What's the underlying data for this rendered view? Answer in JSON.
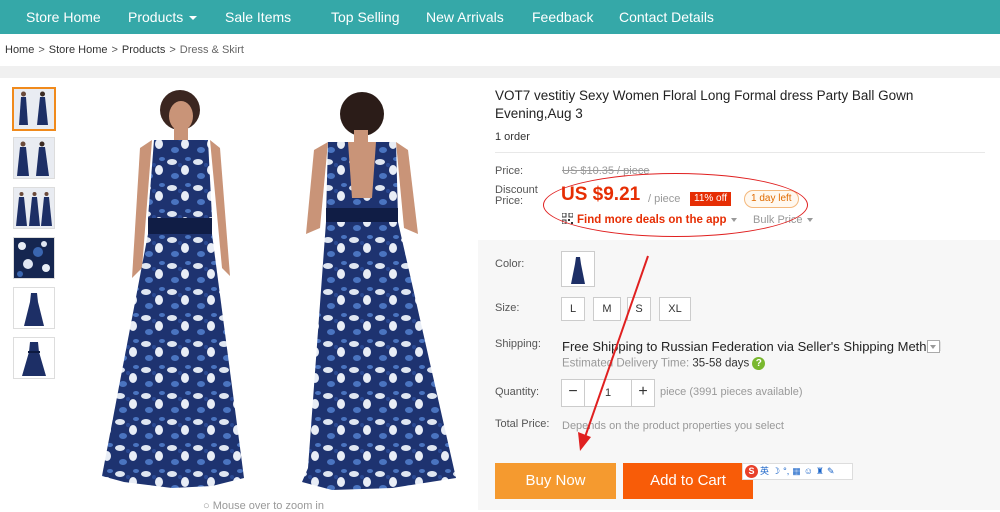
{
  "nav": {
    "items": [
      "Store Home",
      "Products",
      "Sale Items",
      "Top Selling",
      "New Arrivals",
      "Feedback",
      "Contact Details"
    ]
  },
  "breadcrumb": [
    "Home",
    "Store Home",
    "Products",
    "Dress & Skirt"
  ],
  "breadcrumb_separator": ">",
  "gallery": {
    "zoom_hint": "Mouse over to zoom in"
  },
  "product": {
    "title": "VOT7 vestitiy Sexy Women Floral Long Formal dress Party Ball Gown Evening,Aug 3",
    "orders": "1 order"
  },
  "price": {
    "price_label": "Price:",
    "old_price": "US $10.35 / piece",
    "discount_label_1": "Discount",
    "discount_label_2": "Price:",
    "new_price": "US $9.21",
    "per_piece": "/ piece",
    "off_badge": "11% off",
    "time_left": "1 day left",
    "app_deals": "Find more deals on the app",
    "bulk_price": "Bulk Price"
  },
  "options": {
    "color_label": "Color:",
    "size_label": "Size:",
    "sizes": [
      "L",
      "M",
      "S",
      "XL"
    ],
    "shipping_label": "Shipping:",
    "shipping_text": "Free Shipping to Russian Federation via Seller's Shipping Method",
    "delivery_label": "Estimated Delivery Time:",
    "delivery_days": "35-58 days",
    "quantity_label": "Quantity:",
    "quantity_value": "1",
    "quantity_minus": "−",
    "quantity_plus": "+",
    "quantity_note": "piece (3991 pieces available)",
    "total_label": "Total Price:",
    "total_note": "Depends on the product properties you select"
  },
  "actions": {
    "buy_now": "Buy Now",
    "add_to_cart": "Add to Cart"
  },
  "ime_toolbar": {
    "logo": "S",
    "mode": "英"
  },
  "colors": {
    "nav_bg": "#35a8a8",
    "price_red": "#e62e04",
    "buy_now_bg": "#f59a2f",
    "add_to_cart_bg": "#f85c08",
    "annotation_red": "#e02020"
  }
}
